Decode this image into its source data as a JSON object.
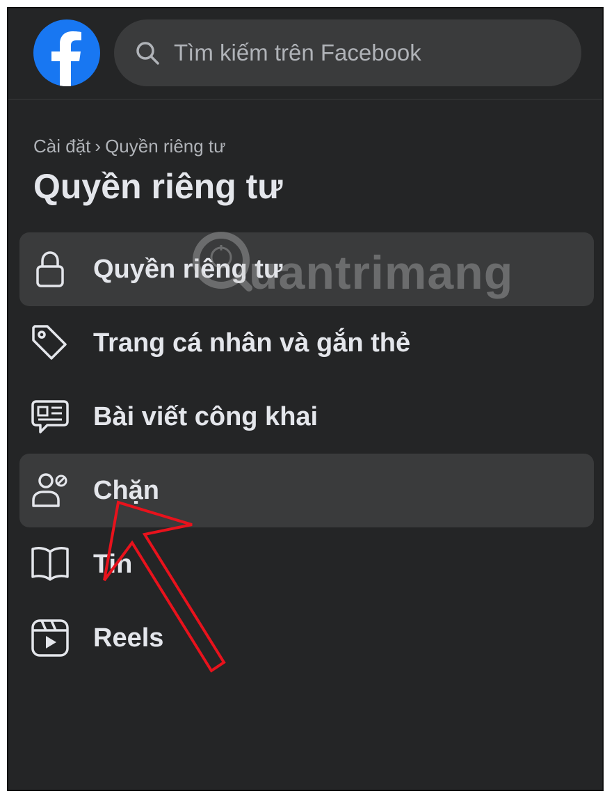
{
  "header": {
    "logo_icon": "facebook-logo-icon",
    "search": {
      "icon": "search-icon",
      "placeholder": "Tìm kiếm trên Facebook"
    }
  },
  "breadcrumb": {
    "parent": "Cài đặt",
    "separator": "›",
    "current": "Quyền riêng tư"
  },
  "page_title": "Quyền riêng tư",
  "menu": {
    "items": [
      {
        "label": "Quyền riêng tư",
        "icon": "lock-icon",
        "active": true
      },
      {
        "label": "Trang cá nhân và gắn thẻ",
        "icon": "tag-icon",
        "active": false
      },
      {
        "label": "Bài viết công khai",
        "icon": "public-posts-icon",
        "active": false
      },
      {
        "label": "Chặn",
        "icon": "block-user-icon",
        "active": false,
        "highlighted": true
      },
      {
        "label": "Tin",
        "icon": "book-icon",
        "active": false
      },
      {
        "label": "Reels",
        "icon": "reels-icon",
        "active": false
      }
    ]
  },
  "watermark": {
    "text": "uantrimang",
    "icon": "quantrimang-logo-icon"
  },
  "annotation": {
    "icon": "red-arrow-icon",
    "color": "#e8121c"
  },
  "colors": {
    "background": "#242526",
    "active_item": "#3a3b3c",
    "text_primary": "#e4e6eb",
    "text_secondary": "#b0b3b8",
    "brand": "#1877f2"
  }
}
